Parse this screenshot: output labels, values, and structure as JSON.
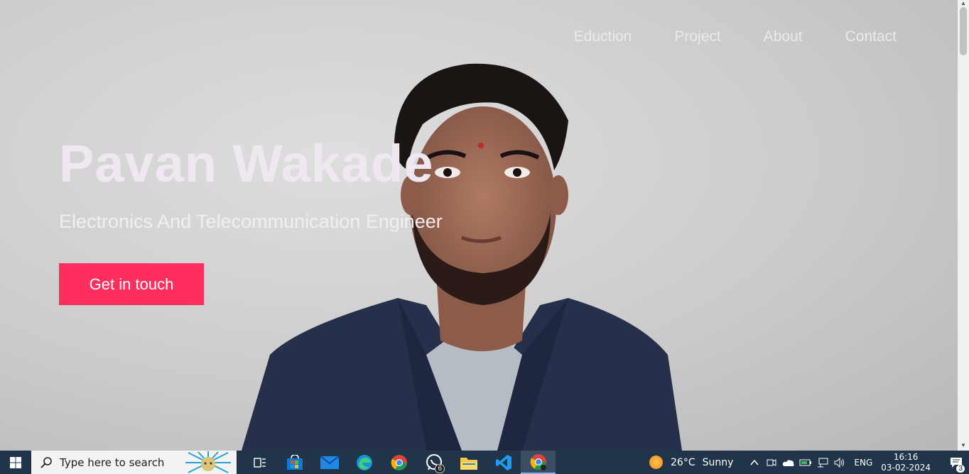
{
  "nav": {
    "items": [
      "Eduction",
      "Project",
      "About",
      "Contact"
    ]
  },
  "hero": {
    "name": "Pavan Wakade",
    "subtitle": "Electronics And Telecommunication Engineer",
    "cta_label": "Get in touch"
  },
  "colors": {
    "accent": "#fe2f5e",
    "taskbar": "#20344a"
  },
  "taskbar": {
    "search_placeholder": "Type here to search",
    "apps": [
      {
        "name": "task-view-icon"
      },
      {
        "name": "microsoft-store-icon"
      },
      {
        "name": "mail-icon"
      },
      {
        "name": "edge-icon"
      },
      {
        "name": "chrome-icon"
      },
      {
        "name": "whatsapp-icon",
        "badge": "6"
      },
      {
        "name": "file-explorer-icon"
      },
      {
        "name": "vscode-icon"
      },
      {
        "name": "chrome-profile-icon",
        "active": true
      }
    ],
    "weather": {
      "temp": "26°C",
      "condition": "Sunny"
    },
    "language": "ENG",
    "time": "16:16",
    "date": "03-02-2024",
    "notifications": "3"
  }
}
